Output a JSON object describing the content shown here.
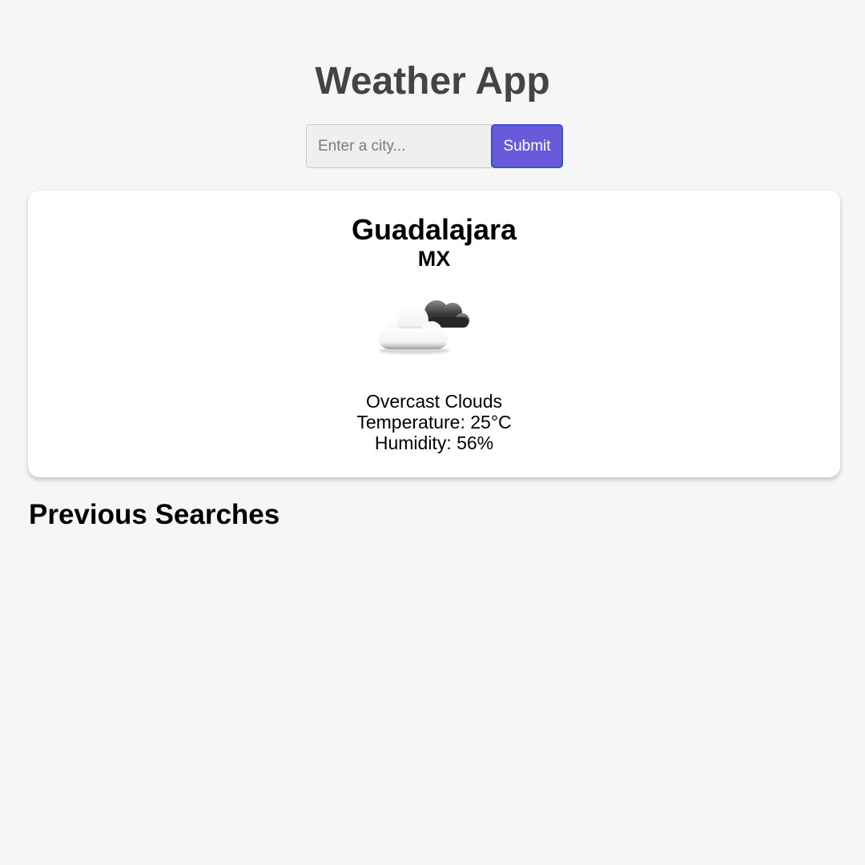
{
  "header": {
    "title": "Weather App"
  },
  "search": {
    "placeholder": "Enter a city...",
    "value": "",
    "submit_label": "Submit"
  },
  "weather": {
    "city": "Guadalajara",
    "country": "MX",
    "icon": "overcast-clouds-icon",
    "description": "Overcast Clouds",
    "temperature_label": "Temperature: 25°C",
    "humidity_label": "Humidity: 56%"
  },
  "previous_searches": {
    "heading": "Previous Searches",
    "items": []
  },
  "colors": {
    "background": "#f6f6f6",
    "title": "#444444",
    "submit_button": "#6a5ad9",
    "submit_border": "#2e56c6",
    "card": "#ffffff"
  }
}
